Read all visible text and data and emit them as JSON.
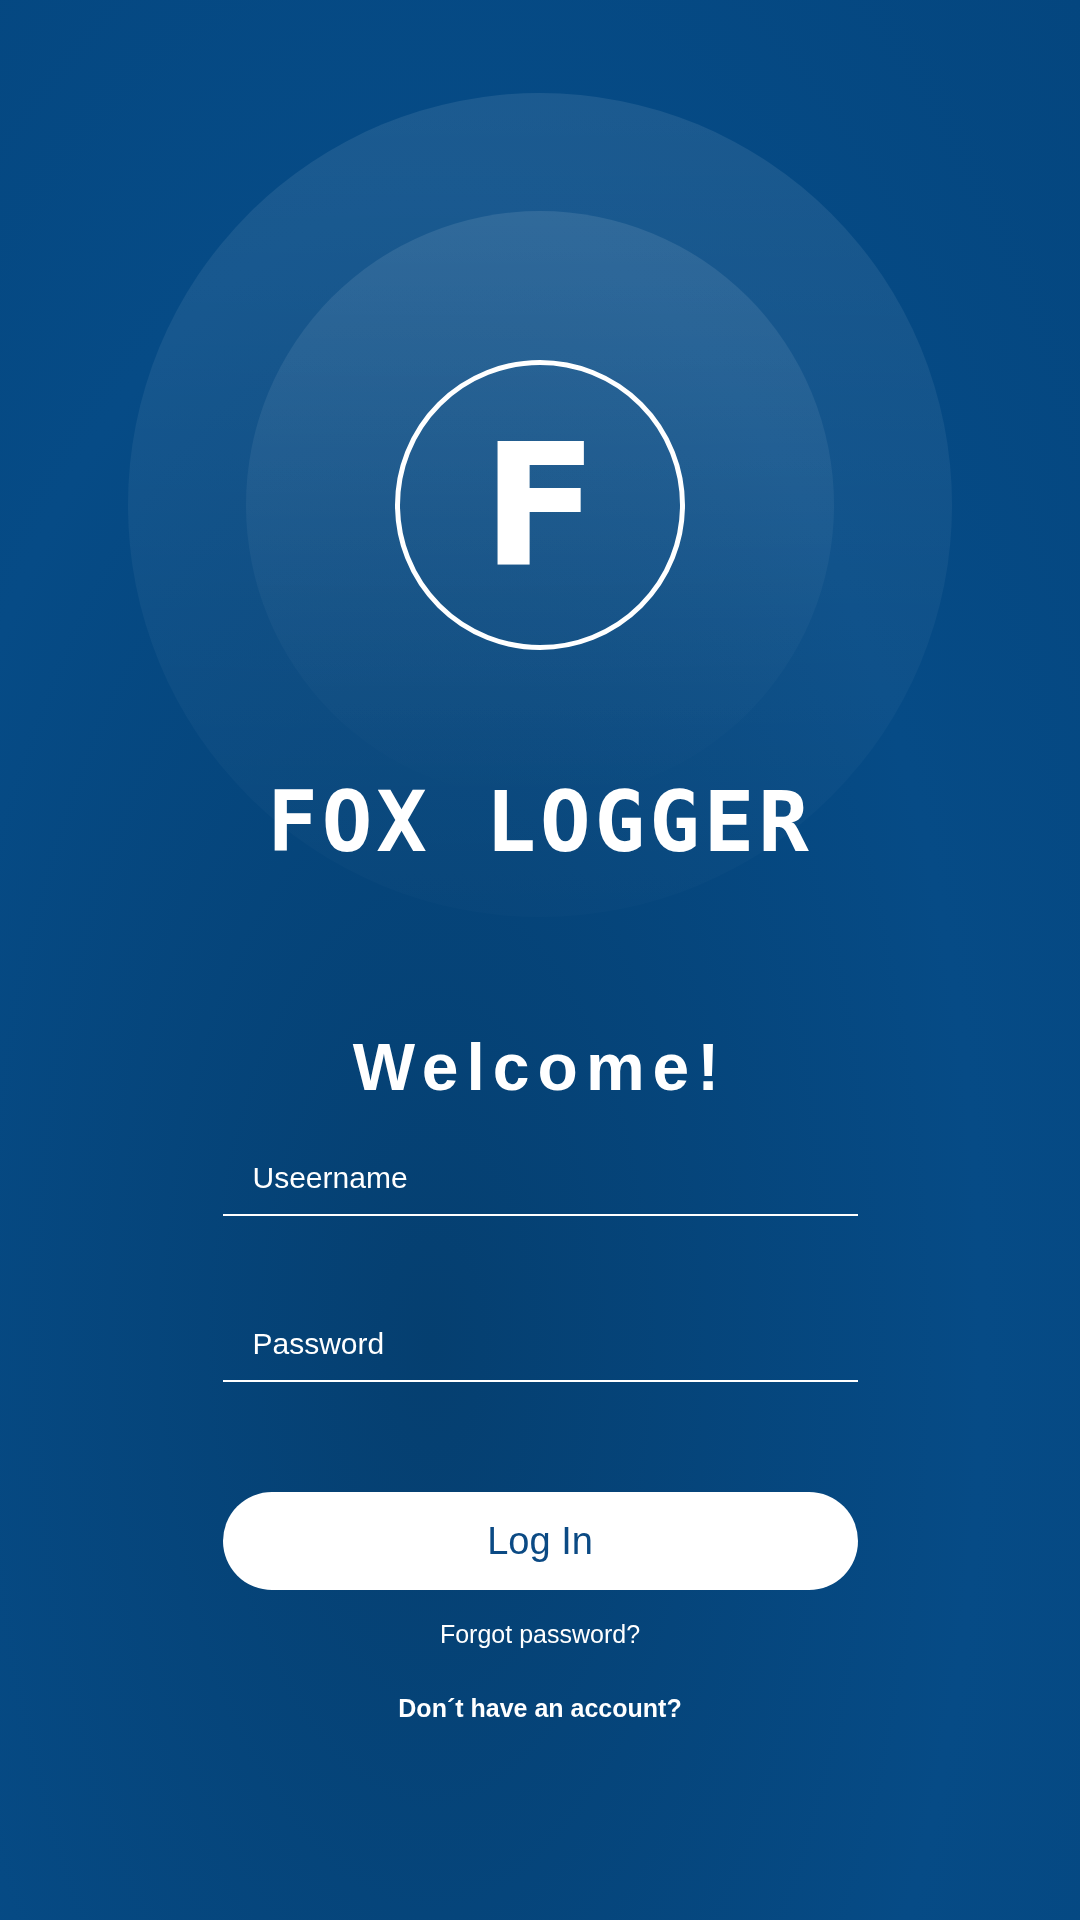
{
  "logo": {
    "letter": "F",
    "name": "FOX LOGGER"
  },
  "heading": "Welcome!",
  "fields": [
    {
      "placeholder": "Useername"
    },
    {
      "placeholder": "Password"
    }
  ],
  "login_button": "Log In",
  "forgot_link": "Forgot password?",
  "signup_link": "Don´t have an account?"
}
